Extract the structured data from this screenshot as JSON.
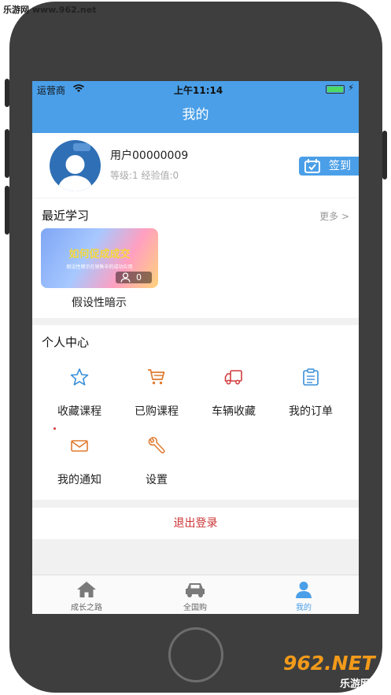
{
  "watermark": {
    "top_text": "乐游网 www.962.net",
    "logo_text": "962.NET",
    "logo_sub": "乐游网"
  },
  "status_bar": {
    "carrier": "运营商",
    "time": "上午11:14"
  },
  "nav": {
    "title": "我的"
  },
  "profile": {
    "username": "用户00000009",
    "info": "等级:1  经验值:0",
    "signin_label": "签到"
  },
  "recent": {
    "title": "最近学习",
    "more": "更多 >",
    "course": {
      "card_title": "如何促成成交",
      "card_subtitle": "假设性暗示在销售中的成功应用",
      "views": "0",
      "name": "假设性暗示"
    }
  },
  "personal_center": {
    "title": "个人中心",
    "items": [
      {
        "label": "收藏课程",
        "icon": "star-icon",
        "color": "#3a8fd8"
      },
      {
        "label": "已购课程",
        "icon": "cart-icon",
        "color": "#e07a2f"
      },
      {
        "label": "车辆收藏",
        "icon": "truck-icon",
        "color": "#d23a3a"
      },
      {
        "label": "我的订单",
        "icon": "clipboard-icon",
        "color": "#3a8fd8"
      },
      {
        "label": "我的通知",
        "icon": "mail-icon",
        "color": "#e07a2f"
      },
      {
        "label": "设置",
        "icon": "wrench-icon",
        "color": "#e07a2f"
      }
    ]
  },
  "logout": {
    "label": "退出登录"
  },
  "tabs": [
    {
      "label": "成长之路",
      "icon": "home-icon"
    },
    {
      "label": "全国购",
      "icon": "car-icon"
    },
    {
      "label": "我的",
      "icon": "user-icon",
      "active": true
    }
  ],
  "colors": {
    "primary": "#4a9fe8",
    "logout": "#cc3333",
    "phone_body": "#3e3e3e"
  }
}
